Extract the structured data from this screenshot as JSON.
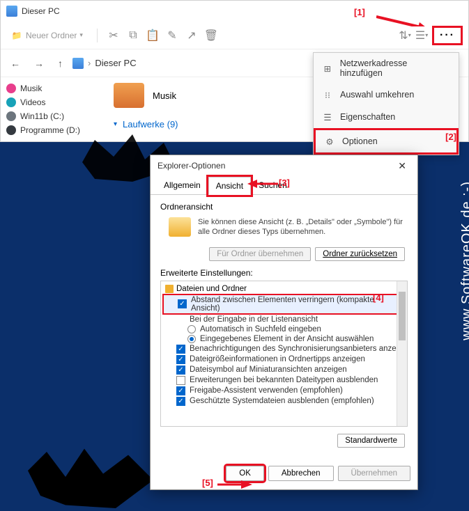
{
  "explorer": {
    "title": "Dieser PC",
    "toolbar": {
      "new_folder": "Neuer Ordner"
    },
    "breadcrumb": "Dieser PC",
    "sidebar": {
      "items": [
        {
          "label": "Musik"
        },
        {
          "label": "Videos"
        },
        {
          "label": "Win11b (C:)"
        },
        {
          "label": "Programme (D:)"
        }
      ]
    },
    "content": {
      "folder": "Musik",
      "section": "Laufwerke (9)"
    }
  },
  "menu": {
    "items": [
      {
        "label": "Netzwerkadresse hinzufügen"
      },
      {
        "label": "Auswahl umkehren"
      },
      {
        "label": "Eigenschaften"
      },
      {
        "label": "Optionen"
      }
    ]
  },
  "dialog": {
    "title": "Explorer-Optionen",
    "tabs": [
      "Allgemein",
      "Ansicht",
      "Suchen"
    ],
    "folder_view": {
      "heading": "Ordneransicht",
      "text": "Sie können diese Ansicht (z. B. „Details\" oder „Symbole\") für alle Ordner dieses Typs übernehmen.",
      "btn_apply": "Für Ordner übernehmen",
      "btn_reset": "Ordner zurücksetzen"
    },
    "advanced": {
      "heading": "Erweiterte Einstellungen:",
      "root": "Dateien und Ordner",
      "items": [
        {
          "type": "check",
          "on": true,
          "label": "Abstand zwischen Elementen verringern (kompakte Ansicht)",
          "hl": true
        },
        {
          "type": "label",
          "label": "Bei der Eingabe in der Listenansicht"
        },
        {
          "type": "radio",
          "on": false,
          "label": "Automatisch in Suchfeld eingeben"
        },
        {
          "type": "radio",
          "on": true,
          "label": "Eingegebenes Element in der Ansicht auswählen"
        },
        {
          "type": "check",
          "on": true,
          "label": "Benachrichtigungen des Synchronisierungsanbieters anzeig"
        },
        {
          "type": "check",
          "on": true,
          "label": "Dateigrößeinformationen in Ordnertipps anzeigen"
        },
        {
          "type": "check",
          "on": true,
          "label": "Dateisymbol auf Miniaturansichten anzeigen"
        },
        {
          "type": "check",
          "on": false,
          "label": "Erweiterungen bei bekannten Dateitypen ausblenden"
        },
        {
          "type": "check",
          "on": true,
          "label": "Freigabe-Assistent verwenden (empfohlen)"
        },
        {
          "type": "check",
          "on": true,
          "label": "Geschützte Systemdateien ausblenden (empfohlen)"
        }
      ]
    },
    "btn_defaults": "Standardwerte",
    "btn_ok": "OK",
    "btn_cancel": "Abbrechen",
    "btn_apply": "Übernehmen"
  },
  "annotations": {
    "n1": "[1]",
    "n2": "[2]",
    "n3": "[3]",
    "n4": "[4]",
    "n5": "[5]"
  },
  "watermark": "www.SoftwareOK.de :-)"
}
